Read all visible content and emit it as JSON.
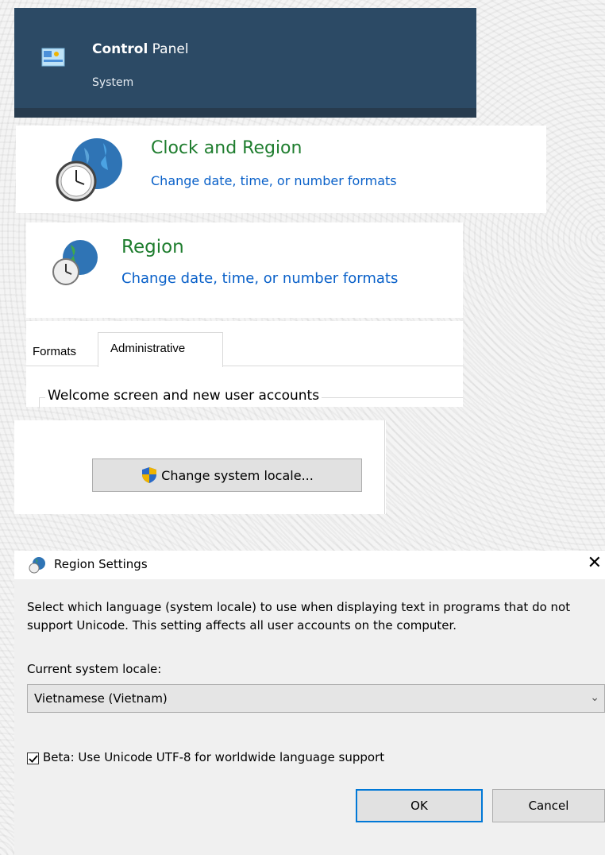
{
  "control_panel": {
    "title_bold": "Control",
    "title_rest": " Panel",
    "subtitle": "System"
  },
  "clock_region": {
    "heading": "Clock and Region",
    "link": "Change date, time, or number formats"
  },
  "region": {
    "heading": "Region",
    "link": "Change date, time, or number formats"
  },
  "region_tabs": {
    "tabs": [
      "Formats",
      "Administrative"
    ],
    "group_label": "Welcome screen and new user accounts"
  },
  "locale_button": {
    "label": "Change system locale..."
  },
  "region_settings_dialog": {
    "title": "Region Settings",
    "description": "Select which language (system locale) to use when displaying text in programs that do not support Unicode. This setting affects all user accounts on the computer.",
    "current_locale_label": "Current system locale:",
    "current_locale_value": "Vietnamese (Vietnam)",
    "beta_checkbox_label": "Beta: Use Unicode UTF-8 for worldwide language support",
    "beta_checked": true,
    "ok_label": "OK",
    "cancel_label": "Cancel"
  },
  "icons": [
    "control-panel-icon",
    "clock-globe-icon",
    "region-icon",
    "uac-shield-icon",
    "close-icon",
    "chevron-down-icon",
    "checkmark-icon"
  ]
}
